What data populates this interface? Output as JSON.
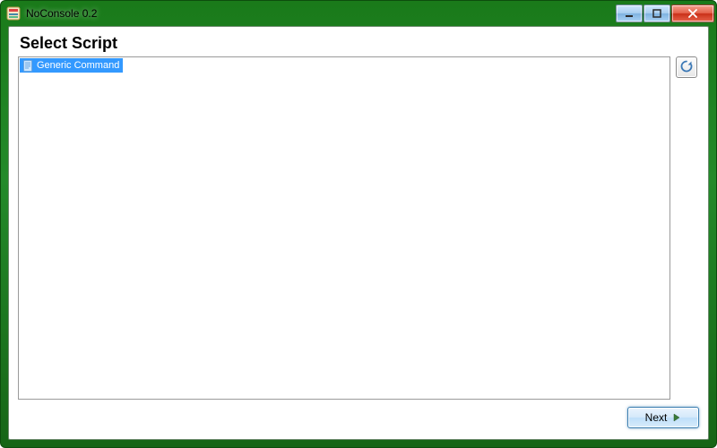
{
  "window": {
    "title": "NoConsole 0.2"
  },
  "page": {
    "heading": "Select Script"
  },
  "scripts": {
    "items": [
      {
        "label": "Generic Command",
        "selected": true
      }
    ]
  },
  "buttons": {
    "next": "Next"
  }
}
